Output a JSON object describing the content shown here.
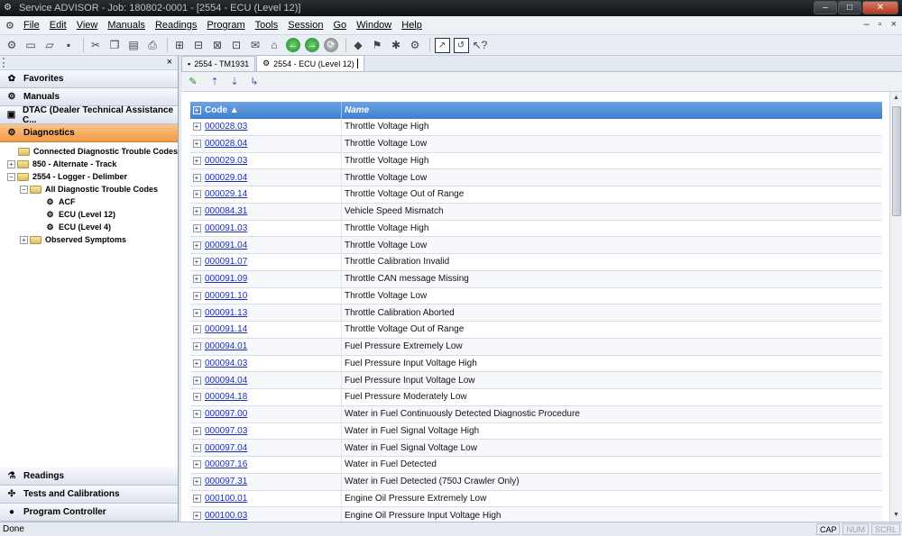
{
  "window": {
    "title": "Service ADVISOR - Job: 180802-0001 - [2554 - ECU (Level 12)]",
    "controls": {
      "minimize": "–",
      "maximize": "□",
      "close": "✕"
    }
  },
  "menubar": {
    "items": [
      "File",
      "Edit",
      "View",
      "Manuals",
      "Readings",
      "Program",
      "Tools",
      "Session",
      "Go",
      "Window",
      "Help"
    ],
    "mdi": {
      "minimize": "–",
      "restore": "▫",
      "close": "×"
    }
  },
  "leftpane": {
    "close": "×",
    "nav_top": [
      {
        "label": "Favorites",
        "icon": "star-icon"
      },
      {
        "label": "Manuals",
        "icon": "manual-icon"
      },
      {
        "label": "DTAC (Dealer Technical Assistance C...",
        "icon": "dtac-icon"
      },
      {
        "label": "Diagnostics",
        "icon": "diagnostics-icon",
        "active": true
      }
    ],
    "tree": [
      "Connected Diagnostic Trouble Codes",
      "850 - Alternate - Track",
      "2554 - Logger - Delimber",
      "All Diagnostic Trouble Codes",
      "ACF",
      "ECU (Level 12)",
      "ECU (Level 4)",
      "Observed Symptoms"
    ],
    "nav_bottom": [
      {
        "label": "Readings",
        "icon": "readings-icon"
      },
      {
        "label": "Tests and Calibrations",
        "icon": "tests-icon"
      },
      {
        "label": "Program Controller",
        "icon": "program-icon"
      }
    ]
  },
  "tabs": [
    "2554 - TM1931",
    "2554 - ECU (Level 12)"
  ],
  "grid": {
    "columns": [
      "Code ▲",
      "Name"
    ],
    "rows": [
      [
        "000028.03",
        "Throttle Voltage High"
      ],
      [
        "000028.04",
        "Throttle Voltage Low"
      ],
      [
        "000029.03",
        "Throttle Voltage High"
      ],
      [
        "000029.04",
        "Throttle Voltage Low"
      ],
      [
        "000029.14",
        "Throttle Voltage Out of Range"
      ],
      [
        "000084.31",
        "Vehicle Speed Mismatch"
      ],
      [
        "000091.03",
        "Throttle Voltage High"
      ],
      [
        "000091.04",
        "Throttle Voltage Low"
      ],
      [
        "000091.07",
        "Throttle Calibration Invalid"
      ],
      [
        "000091.09",
        "Throttle CAN message Missing"
      ],
      [
        "000091.10",
        "Throttle Voltage Low"
      ],
      [
        "000091.13",
        "Throttle Calibration Aborted"
      ],
      [
        "000091.14",
        "Throttle Voltage Out of Range"
      ],
      [
        "000094.01",
        "Fuel Pressure Extremely Low"
      ],
      [
        "000094.03",
        "Fuel Pressure Input Voltage High"
      ],
      [
        "000094.04",
        "Fuel Pressure Input Voltage Low"
      ],
      [
        "000094.18",
        "Fuel Pressure Moderately Low"
      ],
      [
        "000097.00",
        "Water in Fuel Continuously Detected Diagnostic Procedure"
      ],
      [
        "000097.03",
        "Water in Fuel Signal Voltage High"
      ],
      [
        "000097.04",
        "Water in Fuel Signal Voltage Low"
      ],
      [
        "000097.16",
        "Water in Fuel Detected"
      ],
      [
        "000097.31",
        "Water in Fuel Detected (750J Crawler Only)"
      ],
      [
        "000100.01",
        "Engine Oil Pressure Extremely Low"
      ],
      [
        "000100.03",
        "Engine Oil Pressure Input Voltage High"
      ]
    ]
  },
  "statusbar": {
    "text": "Done",
    "indicators": [
      "CAP",
      "NUM",
      "SCRL"
    ]
  }
}
